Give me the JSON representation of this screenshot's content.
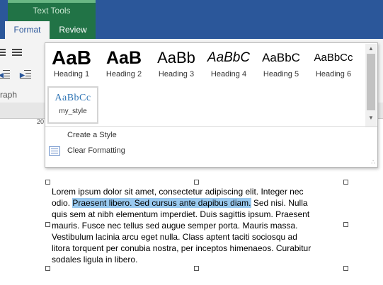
{
  "ribbon": {
    "context_group": "Text Tools",
    "tabs": [
      {
        "label": "Format",
        "active": true
      },
      {
        "label": "Review",
        "active": false
      }
    ],
    "group_label_fragment": "raph"
  },
  "ruler": {
    "number": "20"
  },
  "gallery": {
    "styles": [
      {
        "sample": "AaB",
        "label": "Heading 1"
      },
      {
        "sample": "AaB",
        "label": "Heading 2"
      },
      {
        "sample": "AaBb",
        "label": "Heading 3"
      },
      {
        "sample": "AaBbC",
        "label": "Heading 4"
      },
      {
        "sample": "AaBbC",
        "label": "Heading 5"
      },
      {
        "sample": "AaBbCc",
        "label": "Heading 6"
      }
    ],
    "custom_style": {
      "sample": "AaBbCc",
      "label": "my_style"
    },
    "menu": {
      "create_style": "Create a Style",
      "clear_formatting": "Clear Formatting"
    }
  },
  "document": {
    "lines": [
      {
        "before": "Lorem ipsum dolor sit amet, consectetur adipiscing elit. Integer nec",
        "highlight": "",
        "after": ""
      },
      {
        "before": "odio. ",
        "highlight": "Praesent libero. Sed cursus ante dapibus diam.",
        "after": " Sed nisi. Nulla"
      },
      {
        "before": "quis sem at nibh elementum imperdiet. Duis sagittis ipsum. Praesent",
        "highlight": "",
        "after": ""
      },
      {
        "before": "mauris. Fusce nec tellus sed augue semper porta. Mauris massa.",
        "highlight": "",
        "after": ""
      },
      {
        "before": "Vestibulum lacinia arcu eget nulla. Class aptent taciti sociosqu ad",
        "highlight": "",
        "after": ""
      },
      {
        "before": "litora torquent per conubia nostra, per inceptos himenaeos. Curabitur",
        "highlight": "",
        "after": ""
      },
      {
        "before": "sodales ligula in libero.",
        "highlight": "",
        "after": ""
      }
    ]
  },
  "colors": {
    "ribbon_blue": "#2b579a",
    "context_green": "#217346",
    "selection": "#99c9ef"
  }
}
